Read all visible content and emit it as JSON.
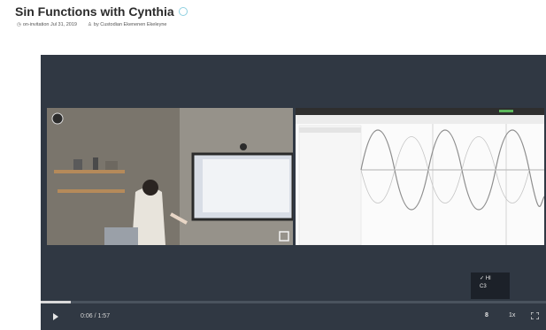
{
  "page": {
    "title": "Sin Functions with Cynthia",
    "date": "on-invitation Jul 31, 2019",
    "author": "by Custodian Ekenenen Ekeleyne"
  },
  "player": {
    "time": "0:06 / 1:57",
    "progress": 0.06,
    "quality_options": [
      "✓ HI",
      "C3"
    ],
    "cc_label": "8",
    "speed_label": "1x"
  },
  "colors": {
    "player_bg": "#303843",
    "progress_bg": "#4a535e",
    "progress_fill": "#d9d9d9"
  }
}
